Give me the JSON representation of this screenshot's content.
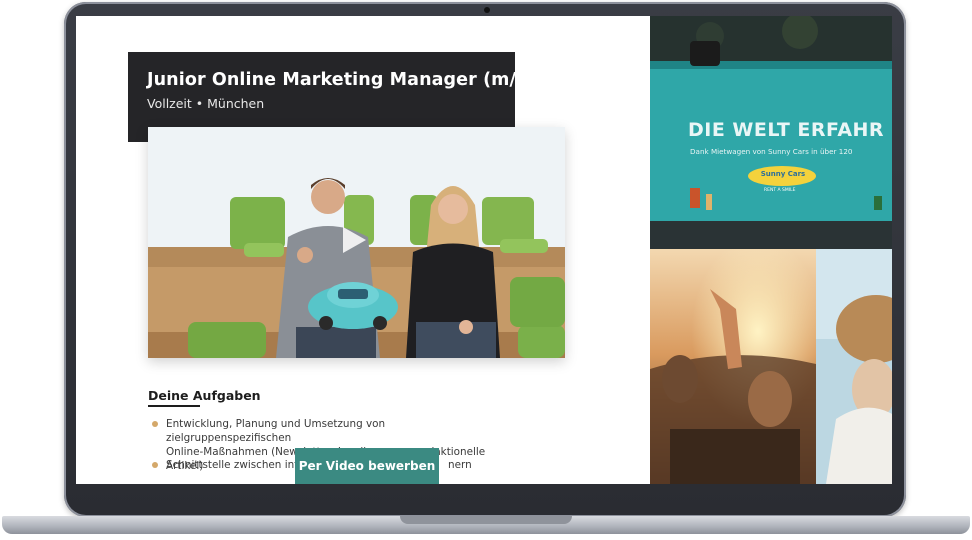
{
  "job": {
    "title": "Junior Online Marketing Manager (m/w/d)",
    "meta": "Vollzeit • München"
  },
  "video": {
    "play_icon": "play-icon"
  },
  "tasks_section": {
    "heading": "Deine Aufgaben",
    "items": [
      {
        "line1": "Entwicklung, Planung und Umsetzung von zielgruppenspezifischen",
        "line2": "Online-Maßnahmen (Newsletter, Landingpages, redaktionelle Artikel)"
      },
      {
        "line1": "Schnittstelle zwischen interne",
        "line1_suffix": "nern"
      }
    ]
  },
  "cta": {
    "label": "Per Video bewerben"
  },
  "gallery": {
    "car_banner_headline": "DIE WELT ERFAHR",
    "car_banner_sub": "Dank Mietwagen von Sunny Cars in über 120",
    "car_logo_text": "Sunny Cars",
    "car_logo_tagline": "RENT A SMILE"
  },
  "colors": {
    "accent": "#3b8a82",
    "title_bg": "#252528",
    "bullet": "#d4a86a"
  }
}
